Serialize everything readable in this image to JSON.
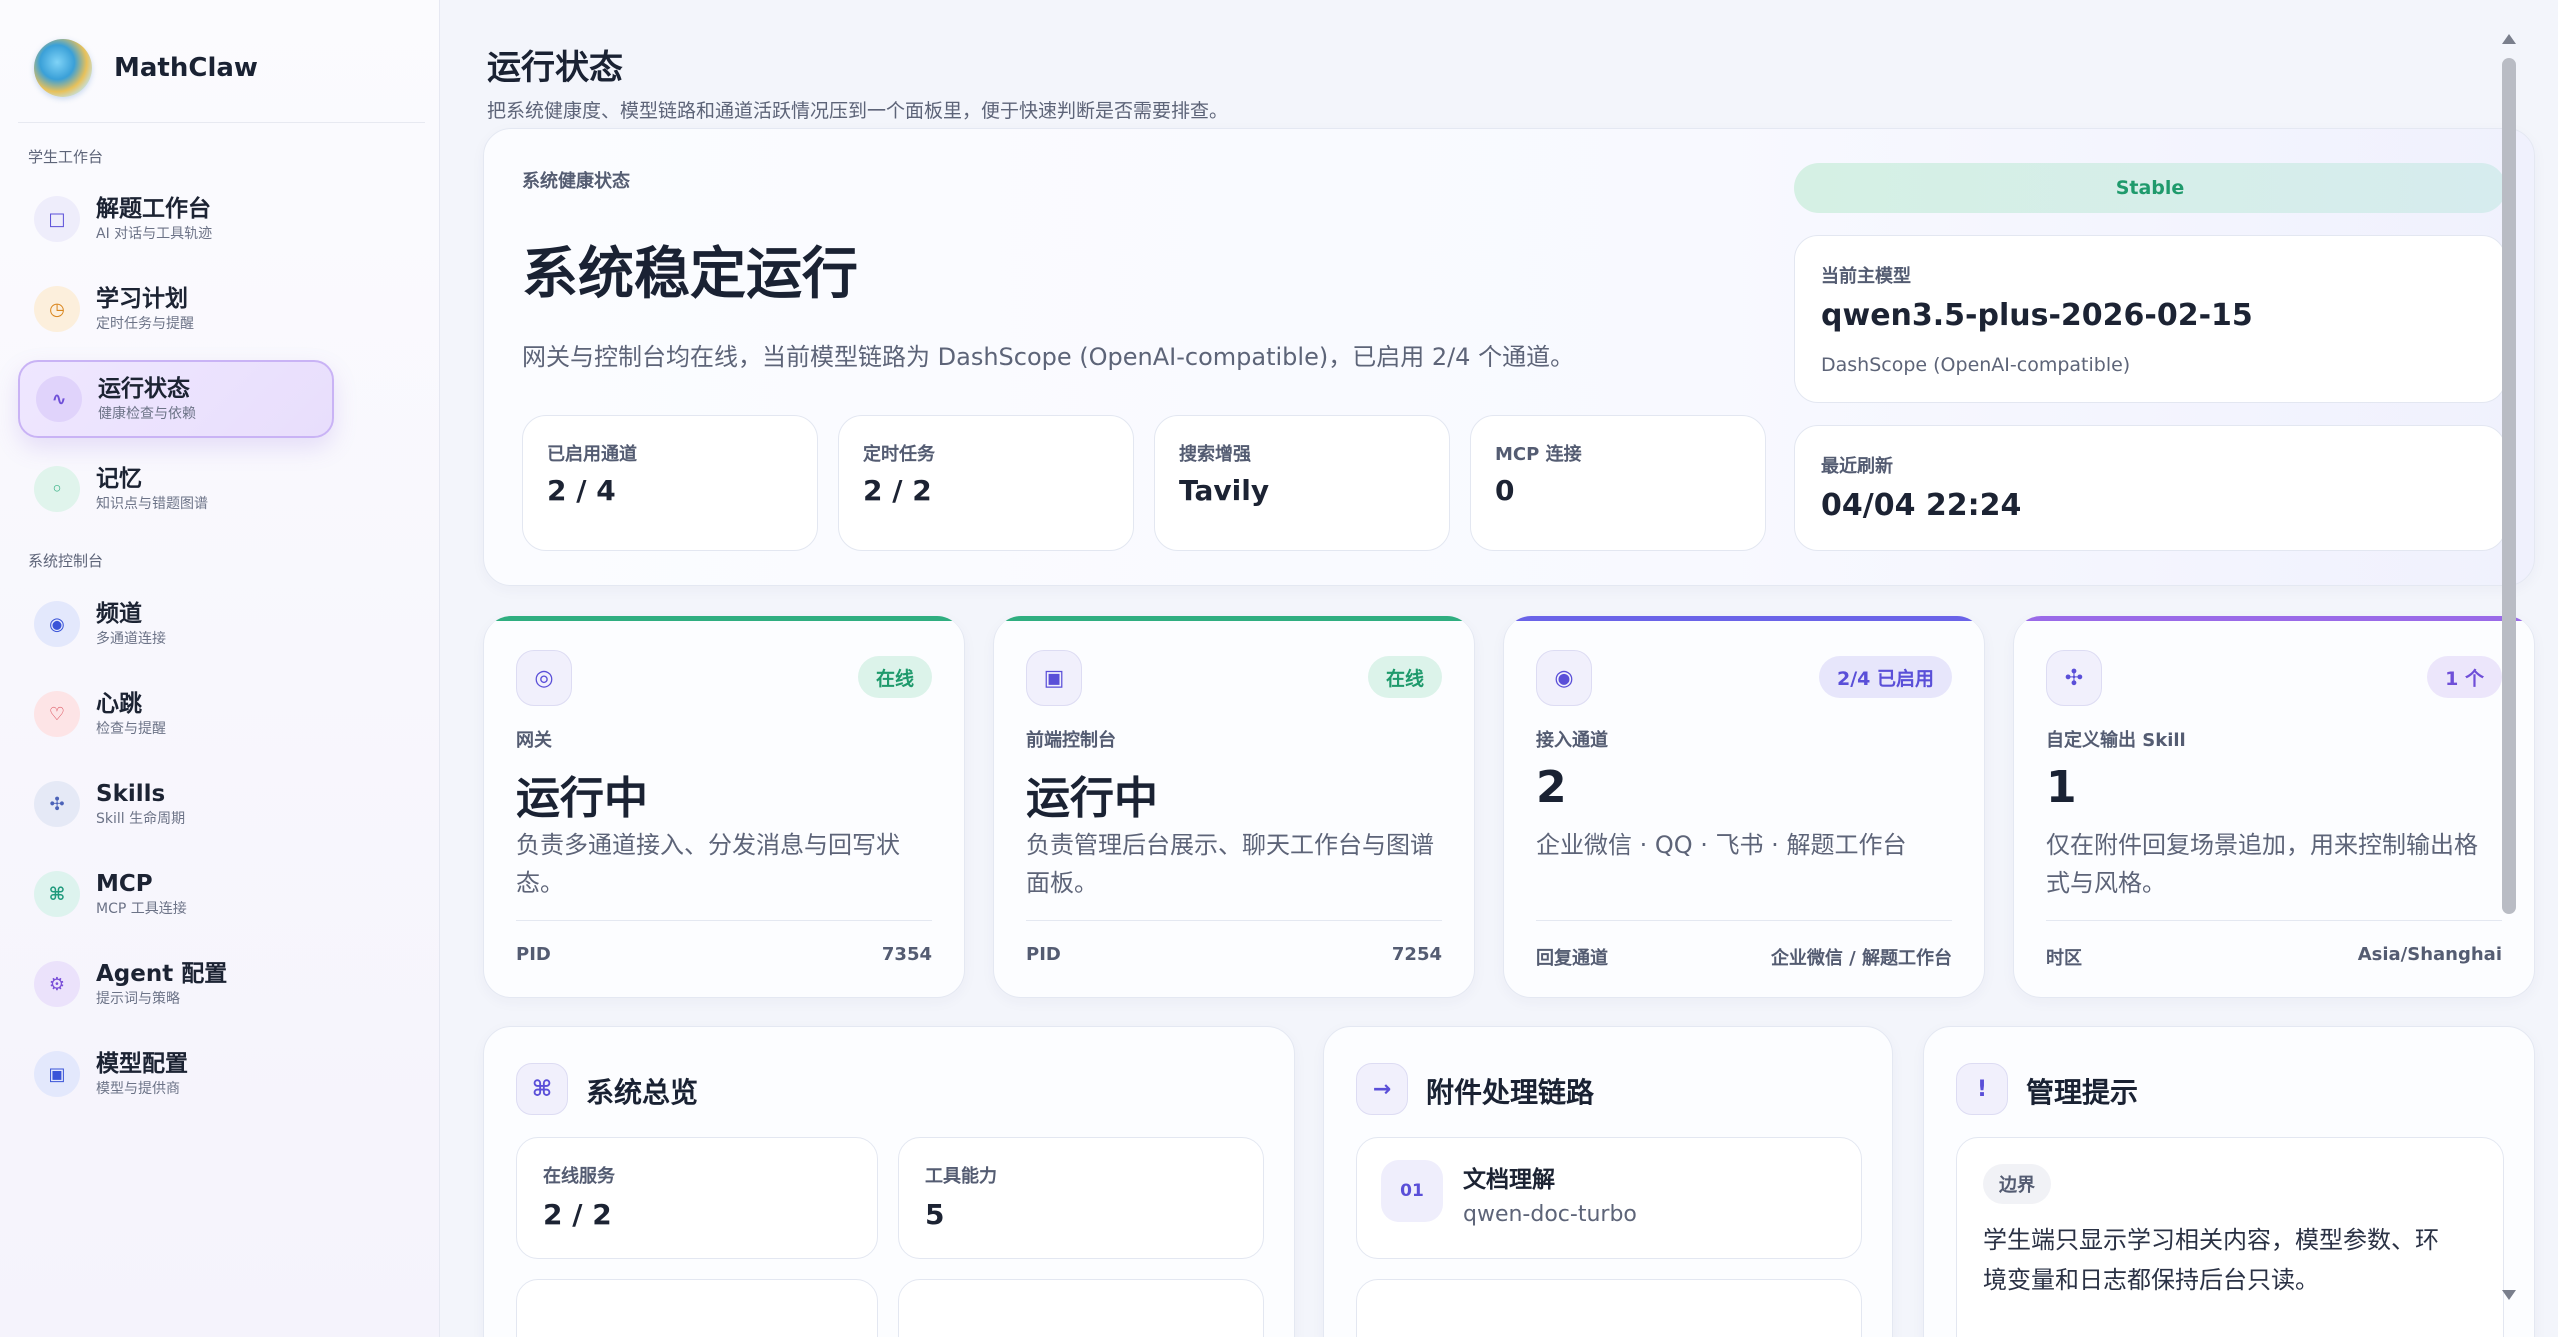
{
  "brand": {
    "name": "MathClaw"
  },
  "sidebar": {
    "groups": [
      {
        "title": "学生工作台"
      },
      {
        "title": "系统控制台"
      }
    ],
    "items": [
      {
        "label": "解题工作台",
        "sub": "AI 对话与工具轨迹",
        "icon": "□"
      },
      {
        "label": "学习计划",
        "sub": "定时任务与提醒",
        "icon": "◷"
      },
      {
        "label": "运行状态",
        "sub": "健康检查与依赖",
        "icon": "∿"
      },
      {
        "label": "记忆",
        "sub": "知识点与错题图谱",
        "icon": "◦"
      },
      {
        "label": "频道",
        "sub": "多通道连接",
        "icon": "◉"
      },
      {
        "label": "心跳",
        "sub": "检查与提醒",
        "icon": "♡"
      },
      {
        "label": "Skills",
        "sub": "Skill 生命周期",
        "icon": "✣"
      },
      {
        "label": "MCP",
        "sub": "MCP 工具连接",
        "icon": "⌘"
      },
      {
        "label": "Agent 配置",
        "sub": "提示词与策略",
        "icon": "⚙"
      },
      {
        "label": "模型配置",
        "sub": "模型与提供商",
        "icon": "▣"
      }
    ]
  },
  "page": {
    "title": "运行状态",
    "subtitle": "把系统健康度、模型链路和通道活跃情况压到一个面板里，便于快速判断是否需要排查。"
  },
  "hero": {
    "kicker": "系统健康状态",
    "title": "系统稳定运行",
    "desc": "网关与控制台均在线，当前模型链路为 DashScope (OpenAI-compatible)，已启用 2/4 个通道。",
    "stats": [
      {
        "label": "已启用通道",
        "value": "2 / 4"
      },
      {
        "label": "定时任务",
        "value": "2 / 2"
      },
      {
        "label": "搜索增强",
        "value": "Tavily"
      },
      {
        "label": "MCP 连接",
        "value": "0"
      }
    ],
    "pill": "Stable",
    "model": {
      "label": "当前主模型",
      "value": "qwen3.5-plus-2026-02-15",
      "sub": "DashScope (OpenAI-compatible)"
    },
    "refresh": {
      "label": "最近刷新",
      "value": "04/04 22:24"
    }
  },
  "status_cards": [
    {
      "icon": "◎",
      "badge": "在线",
      "kicker": "网关",
      "value": "运行中",
      "desc": "负责多通道接入、分发消息与回写状态。",
      "foot_l": "PID",
      "foot_r": "7354",
      "accent": "#2fae80",
      "badge_bg": "#dcf3ea",
      "badge_fg": "#1f9a6c"
    },
    {
      "icon": "▣",
      "badge": "在线",
      "kicker": "前端控制台",
      "value": "运行中",
      "desc": "负责管理后台展示、聊天工作台与图谱面板。",
      "foot_l": "PID",
      "foot_r": "7254",
      "accent": "#2fae80",
      "badge_bg": "#dcf3ea",
      "badge_fg": "#1f9a6c"
    },
    {
      "icon": "◉",
      "badge": "2/4 已启用",
      "kicker": "接入通道",
      "value": "2",
      "desc": "企业微信 · QQ · 飞书 · 解题工作台",
      "foot_l": "回复通道",
      "foot_r": "企业微信 / 解题工作台",
      "accent": "#6a63e8",
      "badge_bg": "#e7e6fb",
      "badge_fg": "#5a4fd8"
    },
    {
      "icon": "✣",
      "badge": "1 个",
      "kicker": "自定义输出 Skill",
      "value": "1",
      "desc": "仅在附件回复场景追加，用来控制输出格式与风格。",
      "foot_l": "时区",
      "foot_r": "Asia/Shanghai",
      "accent": "#9a6ae8",
      "badge_bg": "#ece6fb",
      "badge_fg": "#6f4fd8"
    }
  ],
  "overview": {
    "icon": "⌘",
    "title": "系统总览",
    "items": [
      {
        "label": "在线服务",
        "value": "2 / 2"
      },
      {
        "label": "工具能力",
        "value": "5"
      }
    ]
  },
  "chain": {
    "icon": "→",
    "title": "附件处理链路",
    "items": [
      {
        "num": "01",
        "title": "文档理解",
        "sub": "qwen-doc-turbo"
      }
    ]
  },
  "tips": {
    "icon": "!",
    "title": "管理提示",
    "tag": "边界",
    "text": "学生端只显示学习相关内容，模型参数、环境变量和日志都保持后台只读。"
  }
}
